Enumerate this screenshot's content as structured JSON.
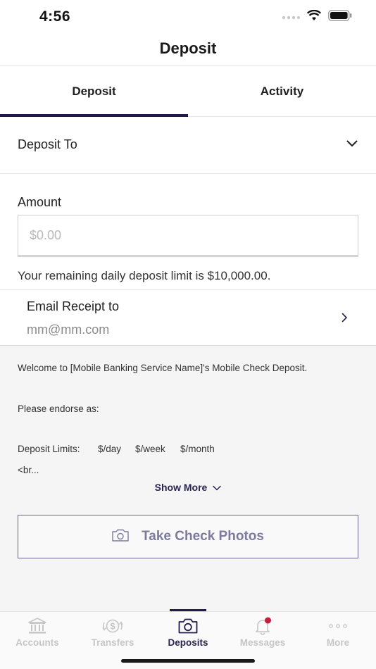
{
  "status_bar": {
    "time": "4:56"
  },
  "nav": {
    "title": "Deposit"
  },
  "tabs": [
    {
      "label": "Deposit",
      "active": true
    },
    {
      "label": "Activity",
      "active": false
    }
  ],
  "deposit_to": {
    "label": "Deposit To"
  },
  "amount": {
    "label": "Amount",
    "placeholder": "$0.00"
  },
  "limit_text": "Your remaining daily deposit limit is $10,000.00.",
  "email_receipt": {
    "label": "Email Receipt to",
    "value": "mm@mm.com"
  },
  "info": {
    "welcome": "Welcome to [Mobile Banking Service Name]'s Mobile Check Deposit.",
    "endorse": "Please endorse as:",
    "limits_label": "Deposit Limits:",
    "limit_day": "$/day",
    "limit_week": "$/week",
    "limit_month": "$/month",
    "truncated": "<br...",
    "show_more": "Show More"
  },
  "take_photos_button": {
    "label": "Take Check Photos"
  },
  "tabbar": {
    "items": [
      {
        "label": "Accounts",
        "icon": "bank-icon",
        "active": false
      },
      {
        "label": "Transfers",
        "icon": "transfer-dollar-icon",
        "active": false
      },
      {
        "label": "Deposits",
        "icon": "camera-icon",
        "active": true
      },
      {
        "label": "Messages",
        "icon": "bell-icon",
        "active": false,
        "badge": true
      },
      {
        "label": "More",
        "icon": "more-dots-icon",
        "active": false
      }
    ]
  },
  "colors": {
    "accent": "#221a4a",
    "badge": "#c0203a",
    "inactive_tab": "#c6c6c6"
  }
}
